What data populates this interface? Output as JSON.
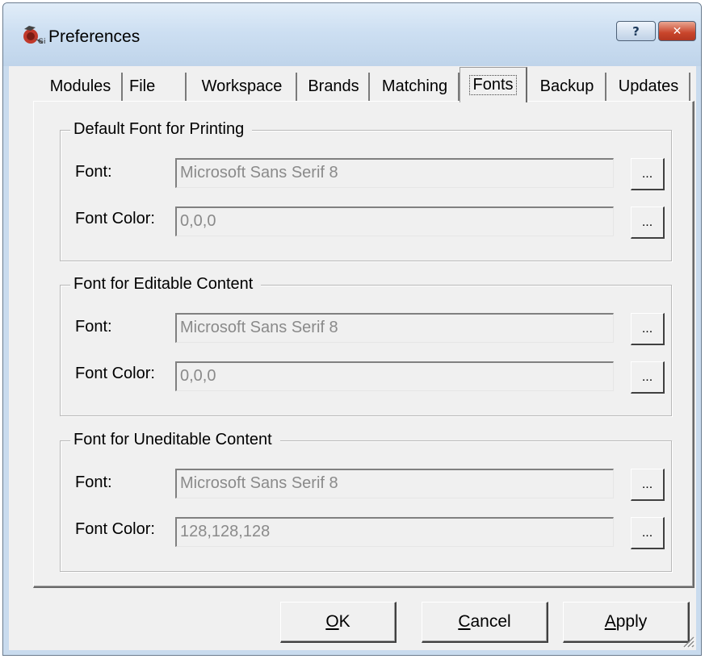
{
  "window": {
    "title": "Preferences",
    "help_label": "?",
    "close_label": "✕"
  },
  "tabs": [
    {
      "label": "Modules"
    },
    {
      "label": "File"
    },
    {
      "label": "Workspace"
    },
    {
      "label": "Brands"
    },
    {
      "label": "Matching"
    },
    {
      "label": "Fonts",
      "active": true
    },
    {
      "label": "Backup"
    },
    {
      "label": "Updates"
    }
  ],
  "groups": [
    {
      "title": "Default Font for Printing",
      "font_label": "Font:",
      "font_value": "Microsoft Sans Serif 8",
      "color_label": "Font Color:",
      "color_value": "0,0,0",
      "browse_label": "..."
    },
    {
      "title": "Font for Editable Content",
      "font_label": "Font:",
      "font_value": "Microsoft Sans Serif 8",
      "color_label": "Font Color:",
      "color_value": "0,0,0",
      "browse_label": "..."
    },
    {
      "title": "Font for Uneditable Content",
      "font_label": "Font:",
      "font_value": "Microsoft Sans Serif 8",
      "color_label": "Font Color:",
      "color_value": "128,128,128",
      "browse_label": "..."
    }
  ],
  "buttons": {
    "ok": {
      "mnemonic": "O",
      "rest": "K"
    },
    "cancel": {
      "mnemonic": "C",
      "rest": "ancel"
    },
    "apply": {
      "mnemonic": "A",
      "rest": "pply"
    }
  },
  "icons": {
    "app": "app-icon",
    "help": "help-icon",
    "close": "close-icon",
    "grip": "resize-grip-icon"
  },
  "colors": {
    "titlebar": "#cddff2",
    "client": "#f0f0f0",
    "close_button": "#c9452b",
    "disabled_text": "#8a8a8a"
  }
}
